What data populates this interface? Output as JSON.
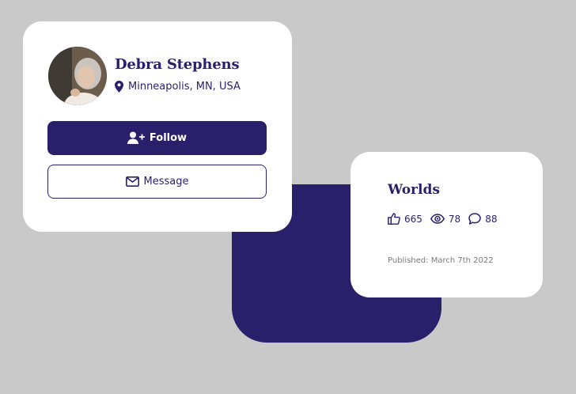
{
  "colors": {
    "background": "#c9c9c9",
    "accent": "#2a1f6b",
    "card": "#ffffff",
    "muted_text": "#7a7a8a"
  },
  "profile": {
    "name": "Debra Stephens",
    "location": "Minneapolis, MN, USA",
    "avatar_icon": "avatar-photo",
    "location_icon": "map-pin-icon",
    "follow_label": "Follow",
    "follow_icon": "user-plus-icon",
    "message_label": "Message",
    "message_icon": "envelope-icon"
  },
  "post": {
    "title": "Worlds",
    "likes": "665",
    "views": "78",
    "comments": "88",
    "like_icon": "thumbs-up-icon",
    "view_icon": "eye-icon",
    "comment_icon": "speech-bubble-icon",
    "published": "Published: March 7th 2022"
  }
}
